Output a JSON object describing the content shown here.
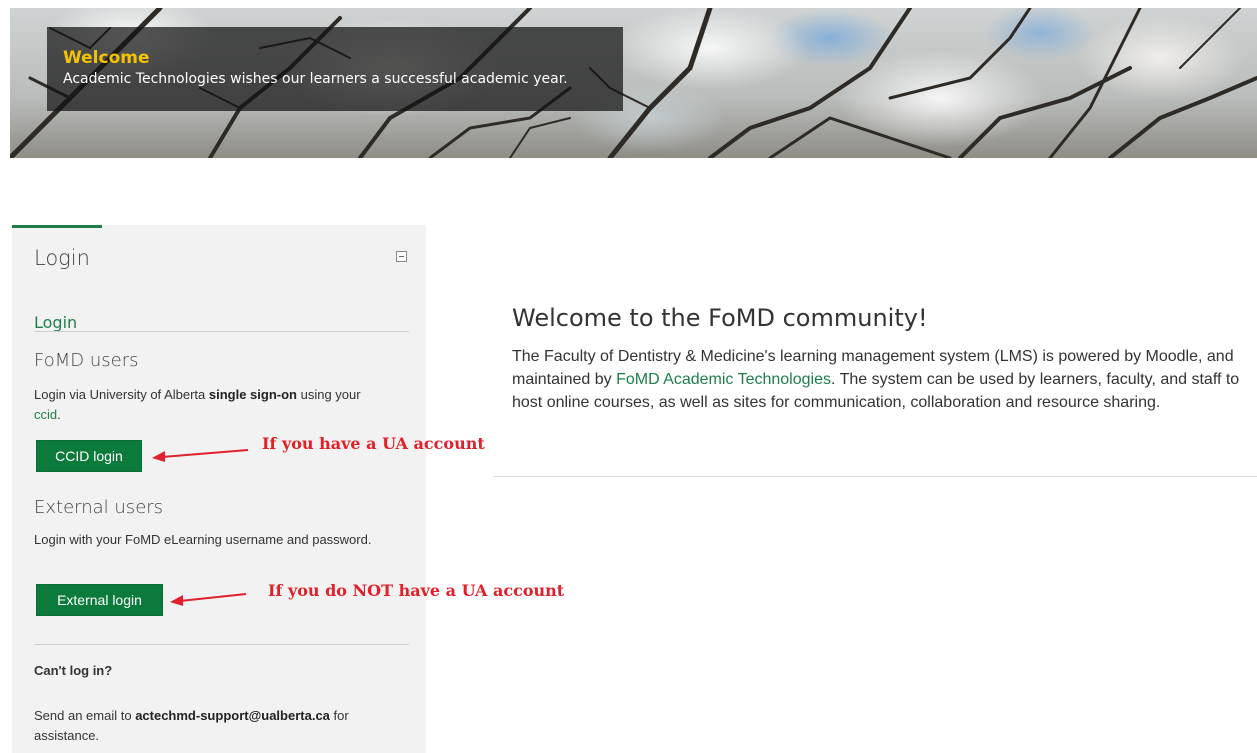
{
  "banner": {
    "title": "Welcome",
    "subtitle": "Academic Technologies wishes our learners a successful academic year."
  },
  "login_block": {
    "title": "Login",
    "login_link": "Login",
    "fomd_heading": "FoMD users",
    "fomd_text_1": "Login via University of Alberta ",
    "fomd_text_bold": "single sign-on",
    "fomd_text_2": " using your ",
    "fomd_ccid_link": "ccid",
    "fomd_text_3": ".",
    "ccid_button": "CCID login",
    "external_heading": "External users",
    "external_text": "Login with your FoMD eLearning username and password.",
    "external_button": "External login",
    "cant_login_heading": "Can't log in?",
    "support_text_1": "Send an email to ",
    "support_email": "actechmd-support@ualberta.ca",
    "support_text_2": " for assistance."
  },
  "annotations": {
    "ua_account": "If you have a UA account",
    "no_ua_account": "If you do NOT have a UA account",
    "color": "#e0202a"
  },
  "main": {
    "title": "Welcome to the FoMD community!",
    "para_1": "The Faculty of Dentistry & Medicine's learning management system (LMS) is powered by Moodle, and maintained by ",
    "para_link": "FoMD Academic Technologies",
    "para_2": ". The system can be used by learners, faculty, and  staff to host online courses, as well as sites for communication, collaboration and resource sharing."
  },
  "colors": {
    "brand_green": "#0b7a3b",
    "link_green": "#1e7f4a",
    "banner_title": "#f4c200"
  }
}
